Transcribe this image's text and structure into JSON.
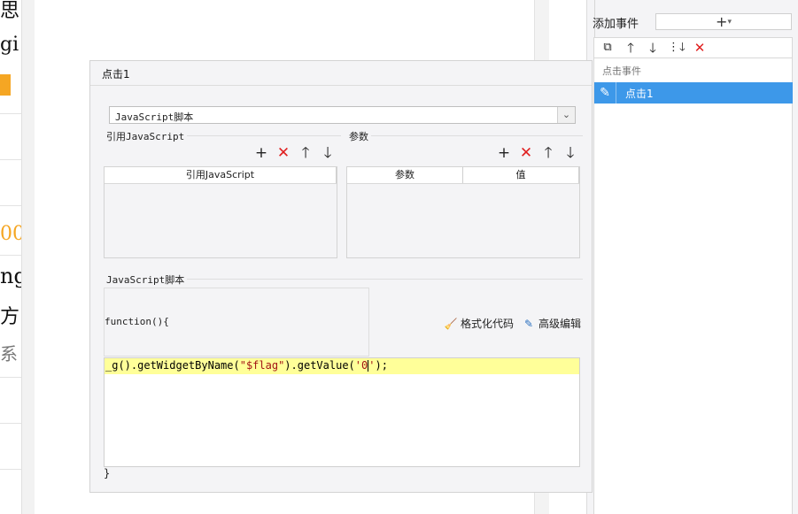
{
  "left_fragments": [
    "思",
    "gi",
    "00",
    "ng",
    "方",
    "系"
  ],
  "accent_orange": "#f5a623",
  "events_panel": {
    "add_label": "添加事件",
    "add_button": "+",
    "group_label": "点击事件",
    "event_name": "点击1",
    "selected_color": "#3d98e9"
  },
  "dialog": {
    "title": "点击1",
    "type_select": "JavaScript脚本",
    "ref_js_group": "引用JavaScript",
    "ref_js_column": "引用JavaScript",
    "params_group": "参数",
    "params_columns": [
      "参数",
      "值"
    ],
    "script_group": "JavaScript脚本",
    "function_head": "function(){",
    "format_code": "格式化代码",
    "advanced_edit": "高级编辑",
    "code": {
      "prefix": "_g().getWidgetByName(",
      "arg1": "\"$flag\"",
      "middle": ").getValue(",
      "arg2_before": "'0",
      "arg2_after": "'",
      "suffix": ");"
    },
    "function_tail": "}"
  }
}
